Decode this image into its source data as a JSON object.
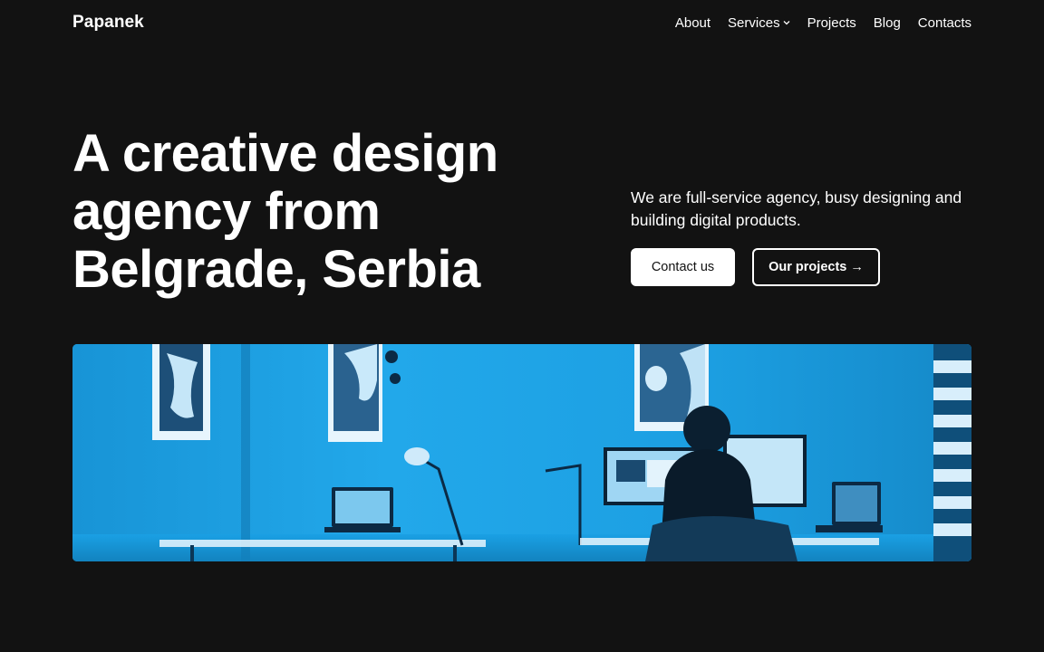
{
  "header": {
    "logo": "Papanek",
    "nav": [
      {
        "label": "About"
      },
      {
        "label": "Services",
        "has_dropdown": true
      },
      {
        "label": "Projects"
      },
      {
        "label": "Blog"
      },
      {
        "label": "Contacts"
      }
    ]
  },
  "hero": {
    "title_lines": [
      "A creative design",
      "agency from",
      "Belgrade, Serbia"
    ],
    "description": "We are full-service agency, busy designing and building digital products.",
    "primary_button": "Contact us",
    "secondary_button": "Our projects →"
  },
  "image": {
    "subject": "office-workspace-photo",
    "tint_color": "#1a9ee0"
  },
  "colors": {
    "background": "#121212",
    "text": "#ffffff",
    "accent_tint": "#1a9ee0"
  }
}
